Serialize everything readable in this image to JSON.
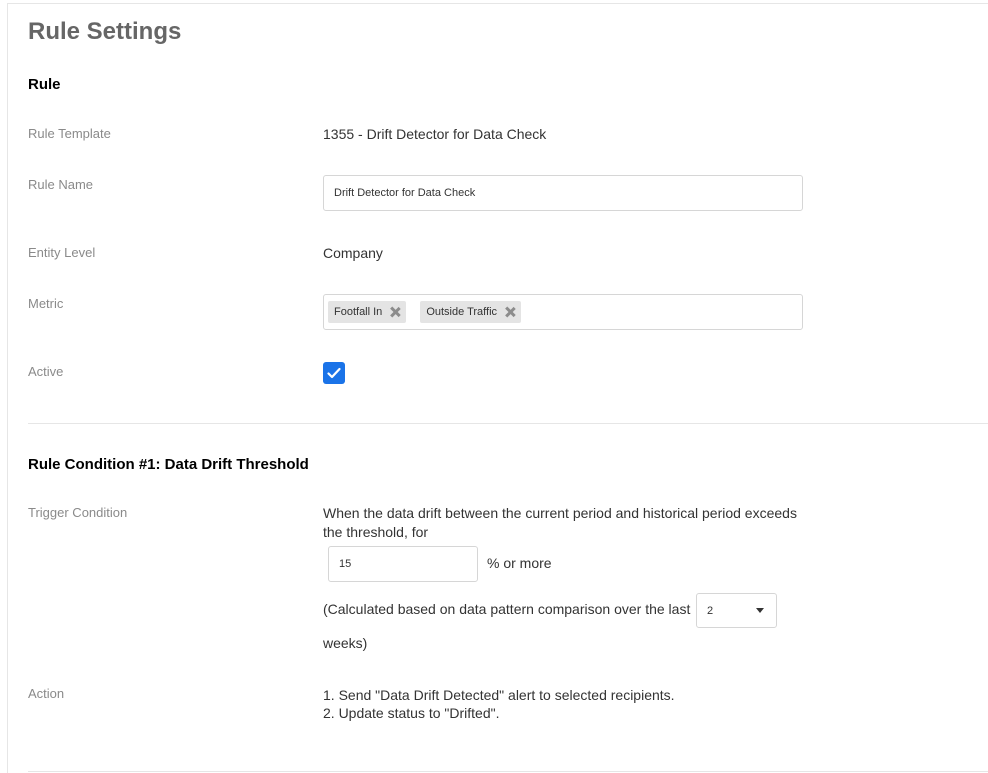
{
  "page": {
    "title": "Rule Settings"
  },
  "rule_section": {
    "title": "Rule",
    "template_label": "Rule Template",
    "template_value": "1355 - Drift Detector for Data Check",
    "name_label": "Rule Name",
    "name_value": "Drift Detector for Data Check",
    "entity_label": "Entity Level",
    "entity_value": "Company",
    "metric_label": "Metric",
    "metrics": [
      "Footfall In",
      "Outside Traffic"
    ],
    "active_label": "Active",
    "active_checked": true
  },
  "condition_section": {
    "title": "Rule Condition #1: Data Drift Threshold",
    "trigger_label": "Trigger Condition",
    "trigger_text": "When the data drift between the current period and historical period exceeds the threshold, for",
    "threshold_value": "15",
    "threshold_suffix": "% or more",
    "calc_prefix": "(Calculated based on data pattern comparison over the last",
    "weeks_value": "2",
    "calc_suffix": "weeks)",
    "action_label": "Action",
    "actions": [
      "1. Send \"Data Drift Detected\" alert to selected recipients.",
      "2. Update status to \"Drifted\"."
    ]
  },
  "icons": {
    "tag_remove": "close-icon",
    "checkbox": "checkmark-icon",
    "select": "caret-down-icon"
  },
  "colors": {
    "accent": "#1a73e8",
    "label": "#8a8a8a",
    "title": "#666666"
  }
}
